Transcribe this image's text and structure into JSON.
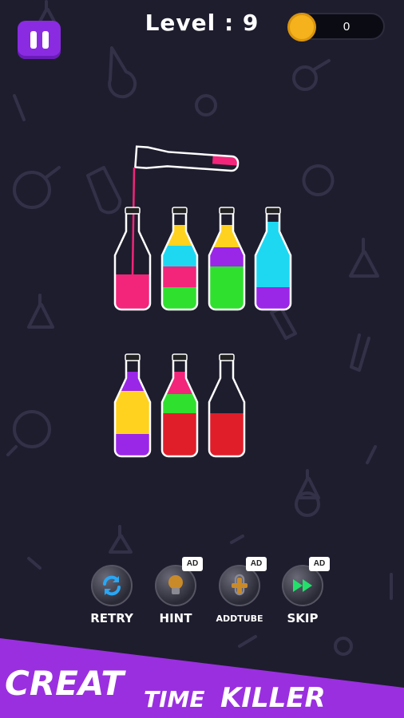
{
  "header": {
    "level_label": "Level : 9",
    "coins": "0"
  },
  "colors": {
    "background": "#1e1d2e",
    "pink": "#f2257a",
    "yellow": "#ffd21f",
    "cyan": "#1ed8f2",
    "green": "#2fe02f",
    "purple": "#9a27e8",
    "red": "#e01e2a",
    "banner": "#9a2fe0"
  },
  "bottles": {
    "pouring": {
      "contents": [
        "pink"
      ]
    },
    "row1": [
      {
        "contents_bottom_to_top": [
          "pink"
        ]
      },
      {
        "contents_bottom_to_top": [
          "green",
          "pink",
          "cyan",
          "yellow"
        ]
      },
      {
        "contents_bottom_to_top": [
          "green",
          "green",
          "purple",
          "yellow"
        ]
      },
      {
        "contents_bottom_to_top": [
          "purple",
          "cyan",
          "cyan",
          "cyan"
        ]
      }
    ],
    "row2": [
      {
        "contents_bottom_to_top": [
          "purple",
          "yellow",
          "yellow",
          "purple"
        ]
      },
      {
        "contents_bottom_to_top": [
          "red",
          "red",
          "green",
          "pink"
        ]
      },
      {
        "contents_bottom_to_top": [
          "red",
          "red"
        ]
      }
    ]
  },
  "buttons": {
    "retry": {
      "label": "RETRY",
      "icon": "refresh-icon"
    },
    "hint": {
      "label": "HINT",
      "icon": "lightbulb-icon",
      "badge": "AD"
    },
    "addtube": {
      "label": "ADDTUBE",
      "icon": "test-tube-icon",
      "badge": "AD"
    },
    "skip": {
      "label": "SKIP",
      "icon": "fast-forward-icon",
      "badge": "AD"
    }
  },
  "banner": {
    "word1": "CREAT",
    "word2": "TIME",
    "word3": "KILLER"
  }
}
